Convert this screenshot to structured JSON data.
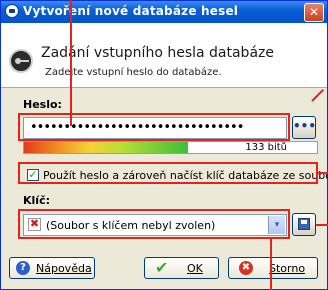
{
  "window": {
    "title": "Vytvoření nové databáze hesel",
    "close_label": "✕"
  },
  "header": {
    "title": "Zadání vstupního hesla databáze",
    "subtitle": "Zadejte vstupní heslo do databáze."
  },
  "password": {
    "label": "Heslo:",
    "value": "••••••••••••••••••••••••••••••••",
    "reveal_label": "•••",
    "quality_text": "133 bitů",
    "quality_fraction": 0.56
  },
  "keyfile_option": {
    "label": "Použít heslo a zároveň načíst klíč databáze ze souboru",
    "checked": true,
    "check_glyph": "✓"
  },
  "key": {
    "label": "Klíč:",
    "selected_value": "(Soubor s klíčem nebyl zvolen)",
    "x_glyph": "✖",
    "dropdown_glyph": "▾"
  },
  "buttons": {
    "help_label": "Nápověda",
    "help_glyph": "?",
    "ok_label": "OK",
    "ok_glyph": "✔",
    "cancel_label": "Storno",
    "cancel_glyph": "✖"
  },
  "colors": {
    "annotation_red": "#e3231e",
    "titlebar_blue": "#0553c7"
  }
}
